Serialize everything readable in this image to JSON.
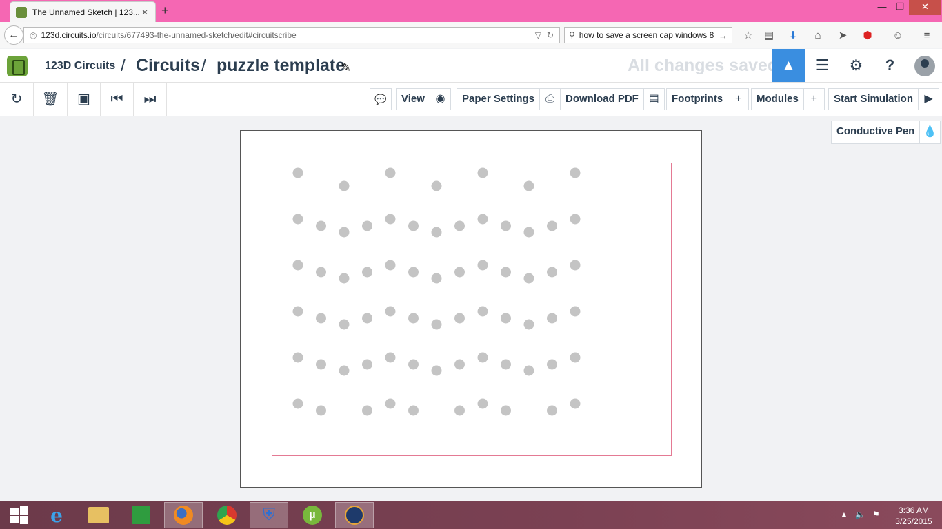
{
  "browser": {
    "tab_title": "The Unnamed Sketch | 123...",
    "tab_close": "✕",
    "new_tab": "+",
    "window_controls": {
      "minimize": "—",
      "restore": "❐",
      "close": "✕"
    },
    "url_host": "123d.circuits.io",
    "url_path": "/circuits/677493-the-unnamed-sketch/edit#circuitscribe",
    "search_text": "how to save a screen cap windows 8"
  },
  "app": {
    "brand": "123D Circuits",
    "breadcrumb": [
      "Circuits",
      "puzzle template"
    ],
    "separator": "/",
    "save_status": "All changes saved"
  },
  "toolbar": {
    "view_label": "View",
    "paper_settings_label": "Paper Settings",
    "download_pdf_label": "Download PDF",
    "footprints_label": "Footprints",
    "modules_label": "Modules",
    "start_simulation_label": "Start Simulation",
    "conductive_pen_label": "Conductive Pen"
  },
  "taskbar": {
    "time": "3:36 AM",
    "date": "3/25/2015"
  },
  "colors": {
    "accent": "#3a8ee0",
    "tabstrip": "#f567b3",
    "dot": "#c4c4c4",
    "margin": "#e47a94",
    "text": "#2c3e50"
  }
}
